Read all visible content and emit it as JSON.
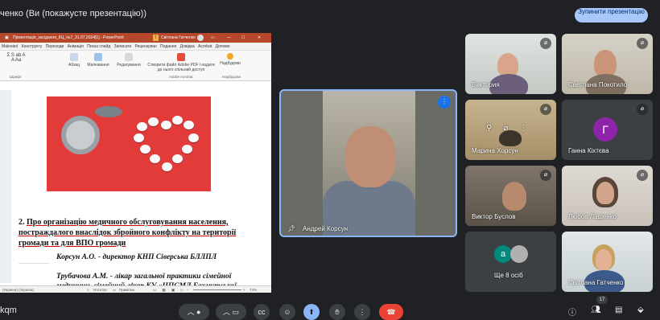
{
  "topbar": {
    "presenting_text": "ченко (Ви (покажусте презентацію))",
    "stop_button": "Зупинити презентацію"
  },
  "powerpoint": {
    "file_title": "Презентація_засідання_КЦ_№7_31.07.2024[1]  -  PowerPoint",
    "user": "Світлана Гатченко",
    "tabs": [
      "Мalování",
      "Конструкту",
      "Переходи",
      "Анімація",
      "Показ слайд",
      "Записати",
      "Рецензуван",
      "Подання",
      "Довідка",
      "Acrobat",
      "Допомо"
    ],
    "ribbon_groups": [
      "Абзац",
      "Малювання",
      "Редагування",
      "Створити файл Adobe PDF і надати до нього спільний доступ",
      "Надбудови"
    ],
    "ribbon_labels": [
      "Шрифт",
      "Adobe Acrobat",
      "Надбудови"
    ],
    "status_left": "(Україна) (Україна)",
    "status_notes": "Нотатки",
    "status_comments": "Примітки",
    "zoom": "74%"
  },
  "slide": {
    "heading_num": "2.",
    "heading": "Про організацію медичного обслуговування населення, постраждалого внаслідок збройного конфлікту на території громади та для ВПО громади",
    "speaker1": "Корсун А.О. - директор КНП Сіверська БЛЛПЛ",
    "speaker2": "Трубачова А.М. - лікар загальної практики сімейної медицини, сімейний лікар КУ «ЦПСМД Бахмутської районної ради»"
  },
  "main_speaker": {
    "name": "Андрей Корсун"
  },
  "participants": [
    {
      "name": "Виктория"
    },
    {
      "name": "Светлана Покотило"
    },
    {
      "name": "Марина Хорсун"
    },
    {
      "name": "Ганна Кіхтєва",
      "initial": "Г"
    },
    {
      "name": "Виктор Буслов"
    },
    {
      "name": "Любов Лащенко"
    },
    {
      "name": "Ще 8 осіб",
      "initial": "a"
    },
    {
      "name": "Світлана Гатченко"
    }
  ],
  "bottombar": {
    "meeting_code": "kqm",
    "participant_count": "17"
  },
  "colors": {
    "accent": "#8ab4f8",
    "stop_bg": "#a8c7fa",
    "end_call": "#ea4335",
    "ppt_brand": "#b7472a",
    "avatar_purple": "#8e24aa",
    "avatar_teal": "#00897b"
  }
}
